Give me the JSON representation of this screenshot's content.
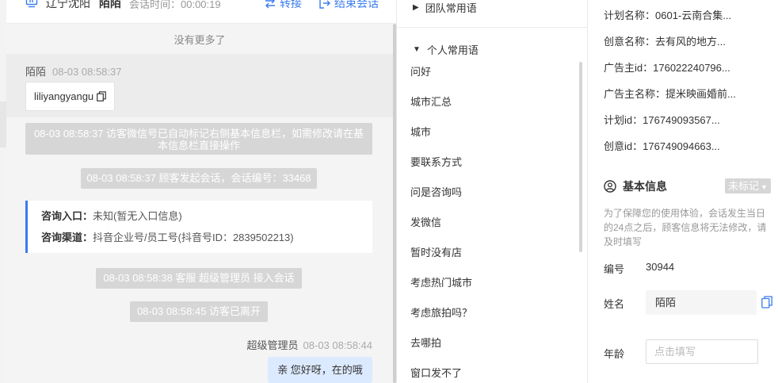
{
  "chat_header": {
    "location": "辽宁沈阳",
    "visitor_name": "陌陌",
    "session_time": "会话时间：00:00:19",
    "transfer_label": "转接",
    "end_label": "结束会话"
  },
  "chat": {
    "no_more": "没有更多了",
    "visitor_msg": {
      "sender": "陌陌",
      "time": "08-03 08:58:37",
      "text": "liliyangyangu"
    },
    "sys1": "08-03 08:58:37 访客微信号已自动标记右侧基本信息栏，如需修改请在基本信息栏直接操作",
    "sys2": "08-03 08:58:37 顾客发起会话，会话编号：33468",
    "info_card": {
      "entry_label": "咨询入口：",
      "entry_value": "未知(暂无入口信息)",
      "channel_label": "咨询渠道：",
      "channel_value": "抖音企业号/员工号(抖音号ID：2839502213)"
    },
    "sys3": "08-03 08:58:38 客服 超级管理员 接入会话",
    "sys4": "08-03 08:58:45 访客已离开",
    "agent_msg": {
      "sender": "超级管理员",
      "time": "08-03 08:58:44",
      "text": "亲 您好呀，在的哦"
    }
  },
  "phrases": {
    "team_group": "团队常用语",
    "personal_group": "个人常用语",
    "items": [
      "问好",
      "城市汇总",
      "城市",
      "要联系方式",
      "问是咨询吗",
      "发微信",
      "暂时没有店",
      "考虑热门城市",
      "考虑旅拍吗？",
      "去哪拍",
      "窗口发不了"
    ]
  },
  "info": {
    "fields": [
      {
        "label": "计划名称：",
        "value": "0601-云南合集..."
      },
      {
        "label": "创意名称：",
        "value": "去有风的地方..."
      },
      {
        "label": "广告主id：",
        "value": "176022240796..."
      },
      {
        "label": "广告主名称：",
        "value": "提米映画婚前..."
      },
      {
        "label": "计划id：",
        "value": "176749093567..."
      },
      {
        "label": "创意id：",
        "value": "176749094663..."
      }
    ],
    "basic_title": "基本信息",
    "tag": "未标记",
    "note": "为了保障您的使用体验，会话发生当日的24点之后，顾客信息将无法修改，请及时填写",
    "number_label": "编号",
    "number_value": "30944",
    "name_label": "姓名",
    "name_value": "陌陌",
    "age_label": "年龄",
    "age_placeholder": "点击填写"
  }
}
